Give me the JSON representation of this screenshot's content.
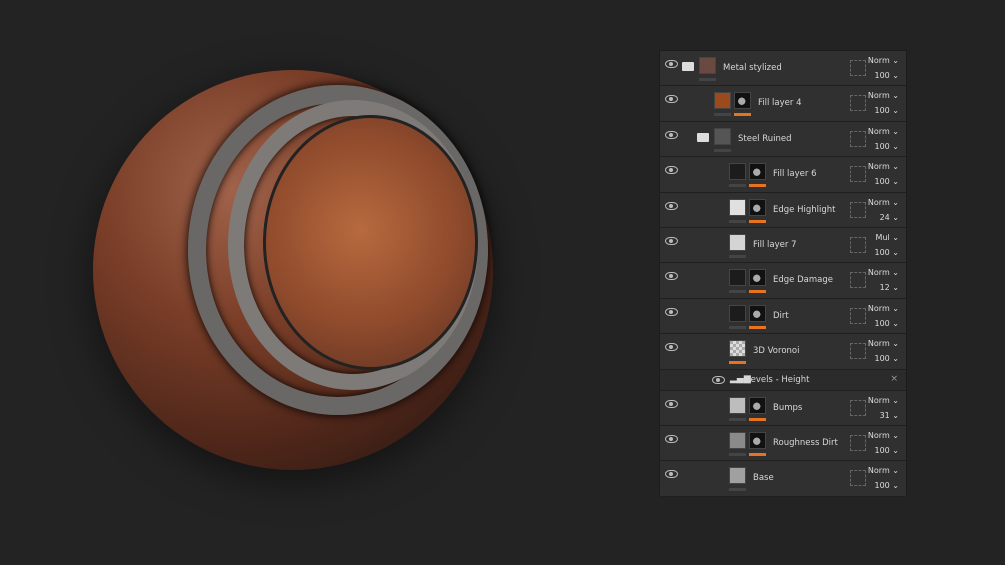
{
  "layers": [
    {
      "name": "Metal stylized",
      "indent": 0,
      "folder": true,
      "thumb": "#6a4a40",
      "mask": false,
      "blend": "Norm",
      "opacity": "100",
      "orange": false
    },
    {
      "name": "Fill layer 4",
      "indent": 1,
      "folder": false,
      "thumb": "#9a4a1c",
      "mask": true,
      "blend": "Norm",
      "opacity": "100",
      "orange": true
    },
    {
      "name": "Steel Ruined",
      "indent": 1,
      "folder": true,
      "thumb": "#555555",
      "mask": false,
      "blend": "Norm",
      "opacity": "100",
      "orange": false
    },
    {
      "name": "Fill layer 6",
      "indent": 2,
      "folder": false,
      "thumb": "#1c1c1c",
      "mask": true,
      "blend": "Norm",
      "opacity": "100",
      "orange": true
    },
    {
      "name": "Edge Highlight",
      "indent": 2,
      "folder": false,
      "thumb": "#e0e0e0",
      "mask": true,
      "blend": "Norm",
      "opacity": "24",
      "orange": true
    },
    {
      "name": "Fill layer 7",
      "indent": 2,
      "folder": false,
      "thumb": "#d4d4d4",
      "mask": false,
      "blend": "Mul",
      "opacity": "100",
      "orange": false
    },
    {
      "name": "Edge Damage",
      "indent": 2,
      "folder": false,
      "thumb": "#1c1c1c",
      "mask": true,
      "blend": "Norm",
      "opacity": "12",
      "orange": true
    },
    {
      "name": "Dirt",
      "indent": 2,
      "folder": false,
      "thumb": "#1c1c1c",
      "mask": true,
      "blend": "Norm",
      "opacity": "100",
      "orange": true
    },
    {
      "name": "3D Voronoi",
      "indent": 2,
      "folder": false,
      "thumb": "#cfcfcf",
      "mask": false,
      "blend": "Norm",
      "opacity": "100",
      "orange": true
    },
    {
      "name": "Levels - Height",
      "sub": true
    },
    {
      "name": "Bumps",
      "indent": 2,
      "folder": false,
      "thumb": "#bdbdbd",
      "mask": true,
      "blend": "Norm",
      "opacity": "31",
      "orange": true
    },
    {
      "name": "Roughness Dirt",
      "indent": 2,
      "folder": false,
      "thumb": "#8a8a8a",
      "mask": true,
      "blend": "Norm",
      "opacity": "100",
      "orange": true
    },
    {
      "name": "Base",
      "indent": 2,
      "folder": false,
      "thumb": "#a0a0a0",
      "mask": false,
      "blend": "Norm",
      "opacity": "100",
      "orange": false
    }
  ],
  "close_glyph": "×",
  "chevron": "⌄"
}
